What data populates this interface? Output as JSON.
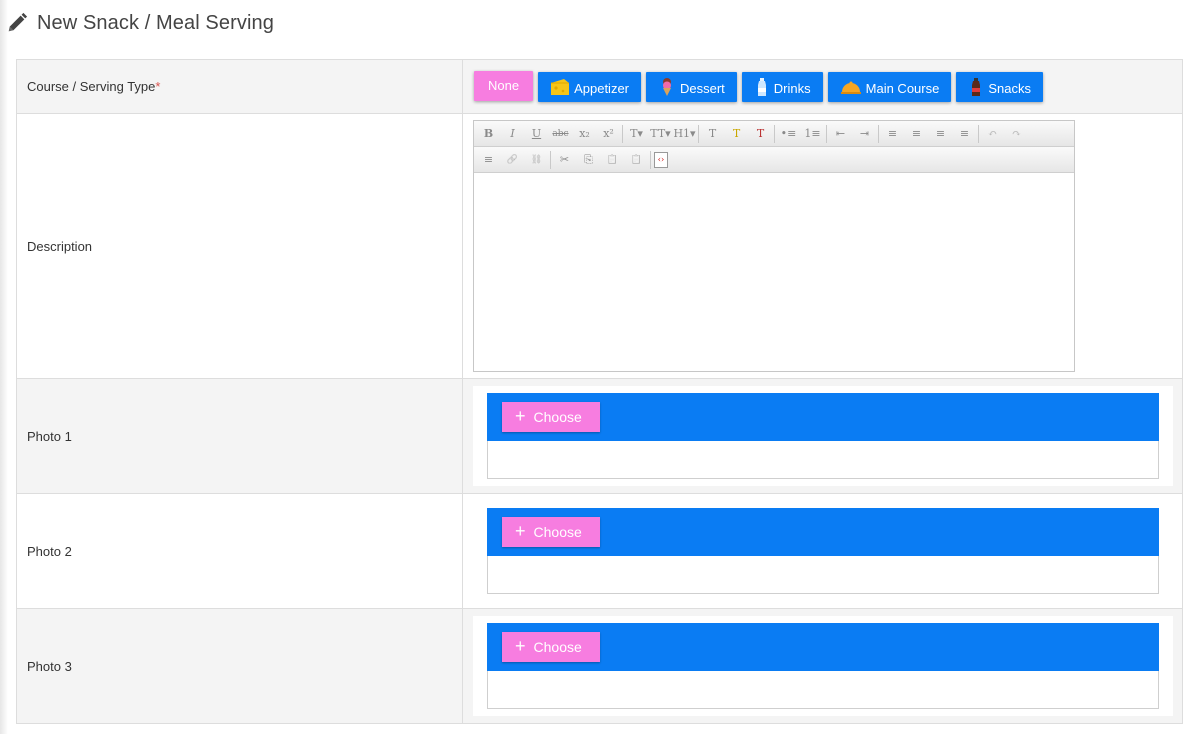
{
  "page": {
    "title": "New Snack / Meal Serving",
    "icon": "pencil-icon"
  },
  "course_type": {
    "label": "Course / Serving Type",
    "required_mark": "*",
    "options": [
      {
        "label": "None",
        "icon": ""
      },
      {
        "label": "Appetizer",
        "icon": "cheese-icon"
      },
      {
        "label": "Dessert",
        "icon": "ice-cream-icon"
      },
      {
        "label": "Drinks",
        "icon": "bottle-icon"
      },
      {
        "label": "Main Course",
        "icon": "cloche-icon"
      },
      {
        "label": "Snacks",
        "icon": "soda-bottle-icon"
      }
    ],
    "selected": "None"
  },
  "description": {
    "label": "Description",
    "toolbar_row1": [
      "B",
      "I",
      "U",
      "abc",
      "x₂",
      "x²",
      "T▾",
      "TT▾",
      "H1▾",
      "T",
      "T",
      "T",
      "•≡",
      "1≡",
      "⇤",
      "⇥",
      "≡",
      "≡",
      "≡",
      "≡",
      "↶",
      "↷"
    ],
    "toolbar_row2": [
      "≡",
      "🔗",
      "⛓",
      "✂",
      "⎘",
      "📋",
      "📋",
      "‹›"
    ]
  },
  "photos": [
    {
      "label": "Photo 1",
      "button": "Choose"
    },
    {
      "label": "Photo 2",
      "button": "Choose"
    },
    {
      "label": "Photo 3",
      "button": "Choose"
    }
  ],
  "colors": {
    "primary": "#0a7cf3",
    "accent": "#f77de0",
    "required": "#d9534f"
  }
}
